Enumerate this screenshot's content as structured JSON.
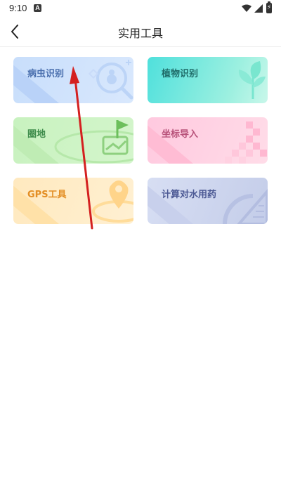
{
  "status_bar": {
    "time": "9:10",
    "notification_glyph": "A",
    "icons": [
      "wifi-icon",
      "signal-icon",
      "battery-charging-icon"
    ]
  },
  "header": {
    "title": "实用工具",
    "back_icon": "chevron-left-icon"
  },
  "tools": [
    {
      "id": "pest",
      "label": "病虫识别",
      "icon": "bug-icon",
      "color": "#4a6fae"
    },
    {
      "id": "plant",
      "label": "植物识别",
      "icon": "leaf-icon",
      "color": "#1f6b68"
    },
    {
      "id": "fence",
      "label": "圈地",
      "icon": "map-flag-icon",
      "color": "#3f8d4c"
    },
    {
      "id": "coord",
      "label": "坐标导入",
      "icon": "grid-import-icon",
      "color": "#b8527a"
    },
    {
      "id": "gps",
      "label": "GPS工具",
      "icon": "location-pin-icon",
      "color": "#e38e24"
    },
    {
      "id": "water",
      "label": "计算对水用药",
      "icon": "ruler-icon",
      "color": "#4c5994"
    }
  ],
  "colors": {
    "background": "#ffffff",
    "annotation_arrow": "#d42020"
  }
}
